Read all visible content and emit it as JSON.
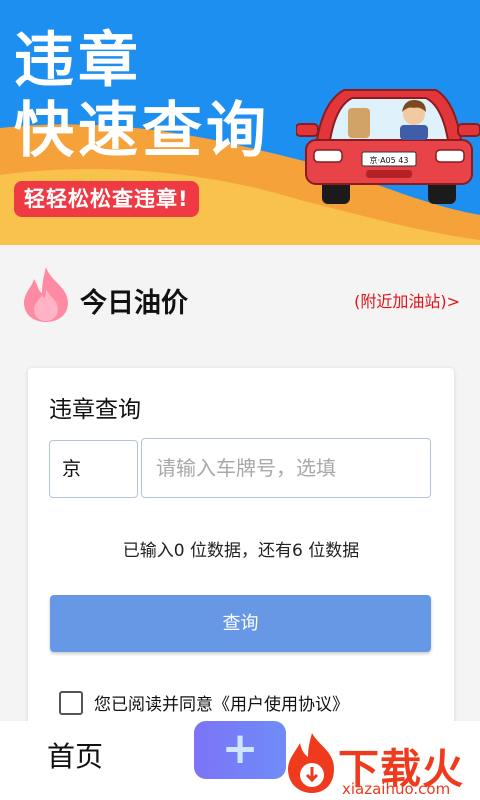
{
  "banner": {
    "line1": "违章",
    "line2": "快速查询",
    "tag": "轻轻松松查违章!",
    "plate_text": "京·A05 43"
  },
  "oil": {
    "title": "今日油价",
    "nearby_link": "(附近加油站)>"
  },
  "query_card": {
    "title": "违章查询",
    "province": "京",
    "plate_placeholder": "请输入车牌号，选填",
    "plate_value": "",
    "count_text": "已输入0 位数据，还有6 位数据",
    "query_button": "查询",
    "agree_text": "您已阅读并同意《用户使用协议》",
    "agree_checked": false
  },
  "bottom_nav": {
    "home_label": "首页",
    "add_icon": "plus-icon"
  },
  "watermark": {
    "text": "下载火",
    "url": "xiazaihuo.com"
  },
  "colors": {
    "banner_blue": "#1d8ff0",
    "banner_orange": "#f6a23a",
    "tag_red": "#ef3a44",
    "link_red": "#e0141c",
    "button_blue": "#6798e6"
  }
}
